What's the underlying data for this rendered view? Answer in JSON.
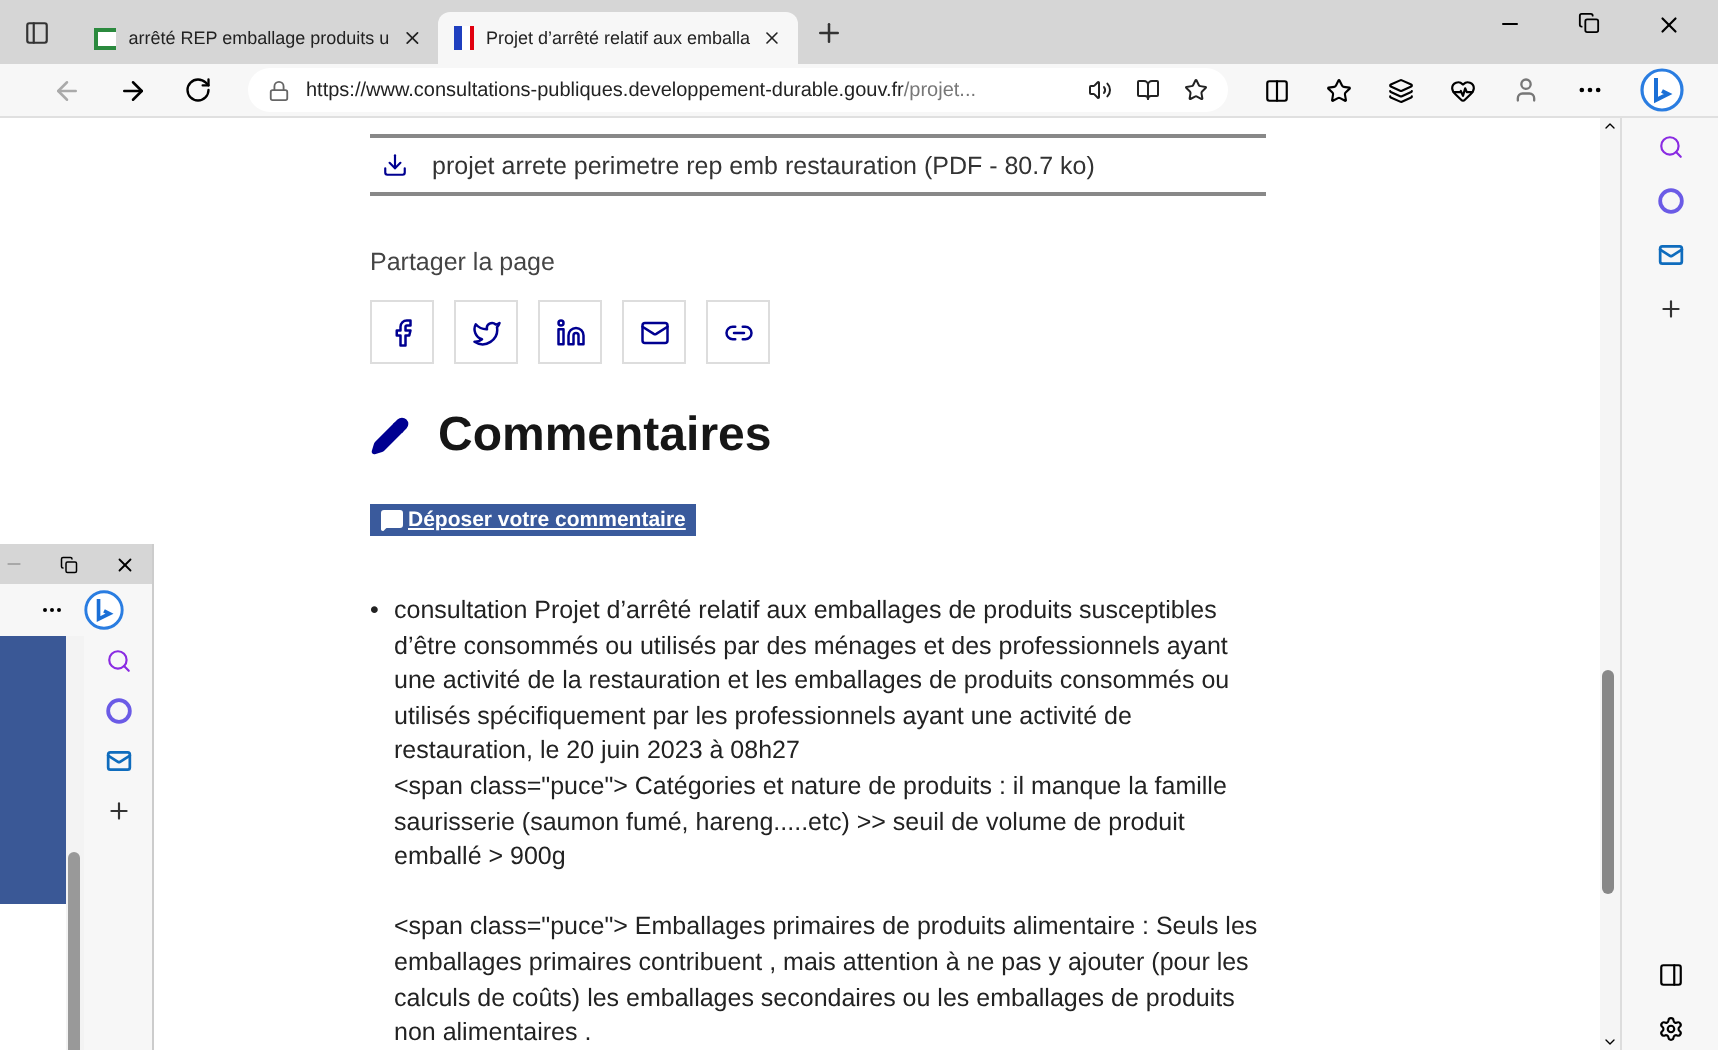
{
  "tabs": [
    {
      "title": "arrêté REP emballage produits u",
      "selected": false,
      "kind": "vp"
    },
    {
      "title": "Projet d’arrêté relatif aux emballa",
      "selected": true,
      "kind": "flag"
    }
  ],
  "address": {
    "host": "https://www.consultations-publiques.developpement-durable.gouv.fr",
    "path": "/projet..."
  },
  "download": {
    "label": "projet arrete perimetre rep emb restauration (PDF - 80.7 ko)"
  },
  "share": {
    "label": "Partager la page",
    "buttons": [
      {
        "kind": "facebook"
      },
      {
        "kind": "twitter"
      },
      {
        "kind": "linkedin"
      },
      {
        "kind": "mail"
      },
      {
        "kind": "link"
      }
    ]
  },
  "comments": {
    "title": "Commentaires",
    "button": "Déposer votre commentaire",
    "items": [
      {
        "bullet": "•",
        "paragraphs": [
          "consultation Projet d’arrêté relatif aux emballages de produits susceptibles d’être consommés ou utilisés par des ménages et des professionnels ayant une activité de la restauration et les emballages de produits consommés ou utilisés spécifiquement par les professionnels ayant une activité de restauration, le 20 juin 2023 à 08h27",
          "<span class=\"puce\"> Catégories et nature de produits : il manque la famille saurisserie (saumon fumé, hareng.....etc) >> seuil de volume de produit emballé > 900g",
          "<span class=\"puce\"> Emballages primaires de produits alimentaire : Seuls les emballages primaires contribuent , mais attention à ne pas y ajouter (pour les calculs de coûts) les emballages secondaires ou les emballages de produits non alimentaires ."
        ]
      }
    ]
  }
}
